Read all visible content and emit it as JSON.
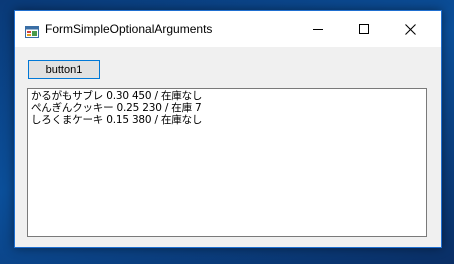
{
  "window": {
    "title": "FormSimpleOptionalArguments",
    "icons": [
      "app-icon",
      "minimize-icon",
      "maximize-icon",
      "close-icon"
    ]
  },
  "toolbar": {
    "button1_label": "button1"
  },
  "textbox": {
    "lines": [
      "かるがもサブレ 0.30 450 / 在庫なし",
      "ぺんぎんクッキー 0.25 230 / 在庫 7",
      "しろくまケーキ 0.15 380 / 在庫なし"
    ]
  },
  "colors": {
    "accent": "#0078d7",
    "window_border": "#1f6fd0",
    "client_bg": "#f0f0f0"
  }
}
